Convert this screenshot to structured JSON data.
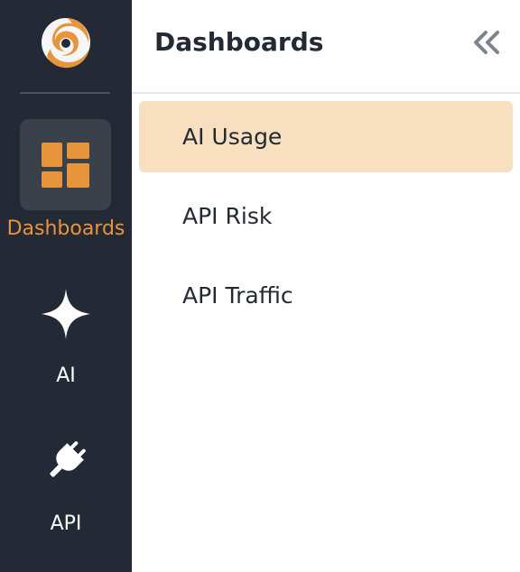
{
  "sidebar": {
    "logo_icon": "company-swirl-logo",
    "items": [
      {
        "label": "Dashboards",
        "icon": "dashboard-grid-icon",
        "active": true
      },
      {
        "label": "AI",
        "icon": "sparkle-icon",
        "active": false
      },
      {
        "label": "API",
        "icon": "plug-icon",
        "active": false
      }
    ]
  },
  "panel": {
    "title": "Dashboards",
    "collapse_icon": "double-chevron-left-icon",
    "items": [
      {
        "label": "AI Usage",
        "active": true
      },
      {
        "label": "API Risk",
        "active": false
      },
      {
        "label": "API Traffic",
        "active": false
      }
    ]
  },
  "colors": {
    "rail_bg": "#232a35",
    "accent": "#e8943a",
    "active_bg": "#f8dfbf",
    "text_dark": "#232a35"
  }
}
